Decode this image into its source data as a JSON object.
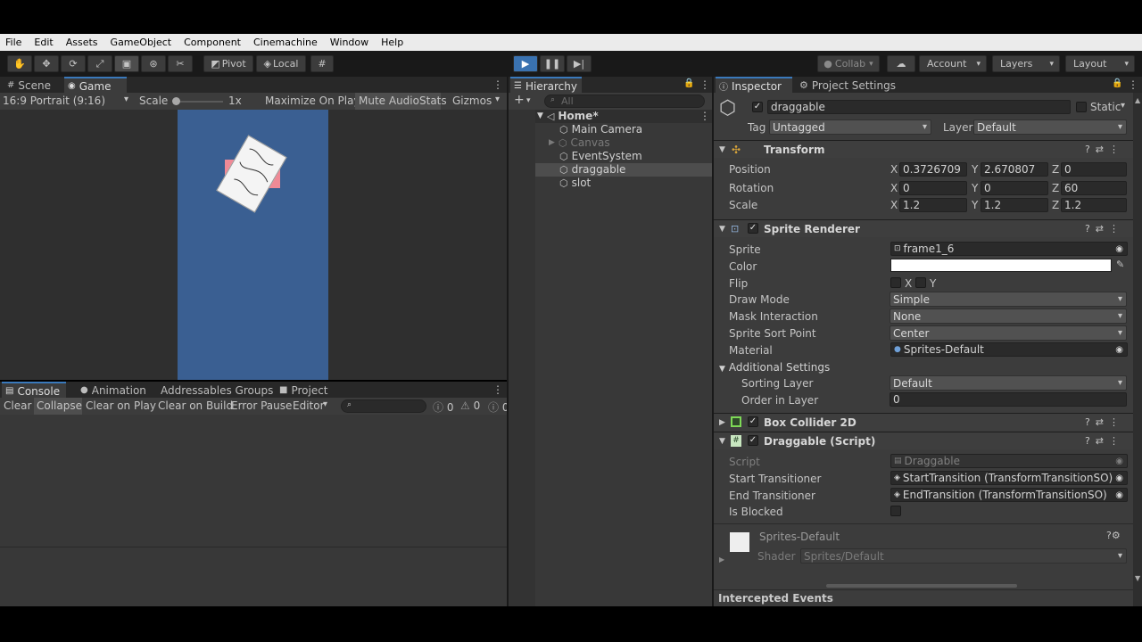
{
  "menu": [
    "File",
    "Edit",
    "Assets",
    "GameObject",
    "Component",
    "Cinemachine",
    "Window",
    "Help"
  ],
  "toolbar": {
    "pivot": "Pivot",
    "local": "Local",
    "collab": "Collab",
    "account": "Account",
    "layers": "Layers",
    "layout": "Layout"
  },
  "game_panel": {
    "tabs": [
      "Scene",
      "Game"
    ],
    "aspect": "16:9 Portrait (9:16)",
    "scale_label": "Scale",
    "scale_value": "1x",
    "buttons": [
      "Maximize On Play",
      "Mute Audio",
      "Stats",
      "Gizmos"
    ],
    "viewport_color": "#3a5f92"
  },
  "console_panel": {
    "tabs": [
      "Console",
      "Animation",
      "Addressables Groups",
      "Project"
    ],
    "buttons": [
      "Clear",
      "Collapse",
      "Clear on Play",
      "Clear on Build",
      "Error Pause",
      "Editor"
    ],
    "counts": [
      "0",
      "0",
      "0"
    ]
  },
  "hierarchy": {
    "tab": "Hierarchy",
    "search_placeholder": "All",
    "scene": "Home*",
    "items": [
      "Main Camera",
      "Canvas",
      "EventSystem",
      "draggable",
      "slot"
    ]
  },
  "inspector": {
    "tabs": [
      "Inspector",
      "Project Settings"
    ],
    "object_name": "draggable",
    "static_label": "Static",
    "tag_label": "Tag",
    "tag_value": "Untagged",
    "layer_label": "Layer",
    "layer_value": "Default",
    "transform": {
      "title": "Transform",
      "position_label": "Position",
      "position": [
        "0.3726709",
        "2.670807",
        "0"
      ],
      "rotation_label": "Rotation",
      "rotation": [
        "0",
        "0",
        "60"
      ],
      "scale_label": "Scale",
      "scale": [
        "1.2",
        "1.2",
        "1.2"
      ],
      "axes": [
        "X",
        "Y",
        "Z"
      ]
    },
    "sprite_renderer": {
      "title": "Sprite Renderer",
      "sprite_label": "Sprite",
      "sprite_value": "frame1_6",
      "color_label": "Color",
      "flip_label": "Flip",
      "flip_axes": [
        "X",
        "Y"
      ],
      "draw_mode_label": "Draw Mode",
      "draw_mode": "Simple",
      "mask_label": "Mask Interaction",
      "mask": "None",
      "sort_point_label": "Sprite Sort Point",
      "sort_point": "Center",
      "material_label": "Material",
      "material": "Sprites-Default",
      "additional_label": "Additional Settings",
      "sorting_layer_label": "Sorting Layer",
      "sorting_layer": "Default",
      "order_label": "Order in Layer",
      "order": "0"
    },
    "box_collider": {
      "title": "Box Collider 2D"
    },
    "draggable_script": {
      "title": "Draggable (Script)",
      "script_label": "Script",
      "script_value": "Draggable",
      "start_label": "Start Transitioner",
      "start_value": "StartTransition (TransformTransitionSO)",
      "end_label": "End Transitioner",
      "end_value": "EndTransition (TransformTransitionSO)",
      "blocked_label": "Is Blocked"
    },
    "material_section": {
      "name": "Sprites-Default",
      "shader_label": "Shader",
      "shader_value": "Sprites/Default"
    },
    "intercepted": "Intercepted Events"
  }
}
